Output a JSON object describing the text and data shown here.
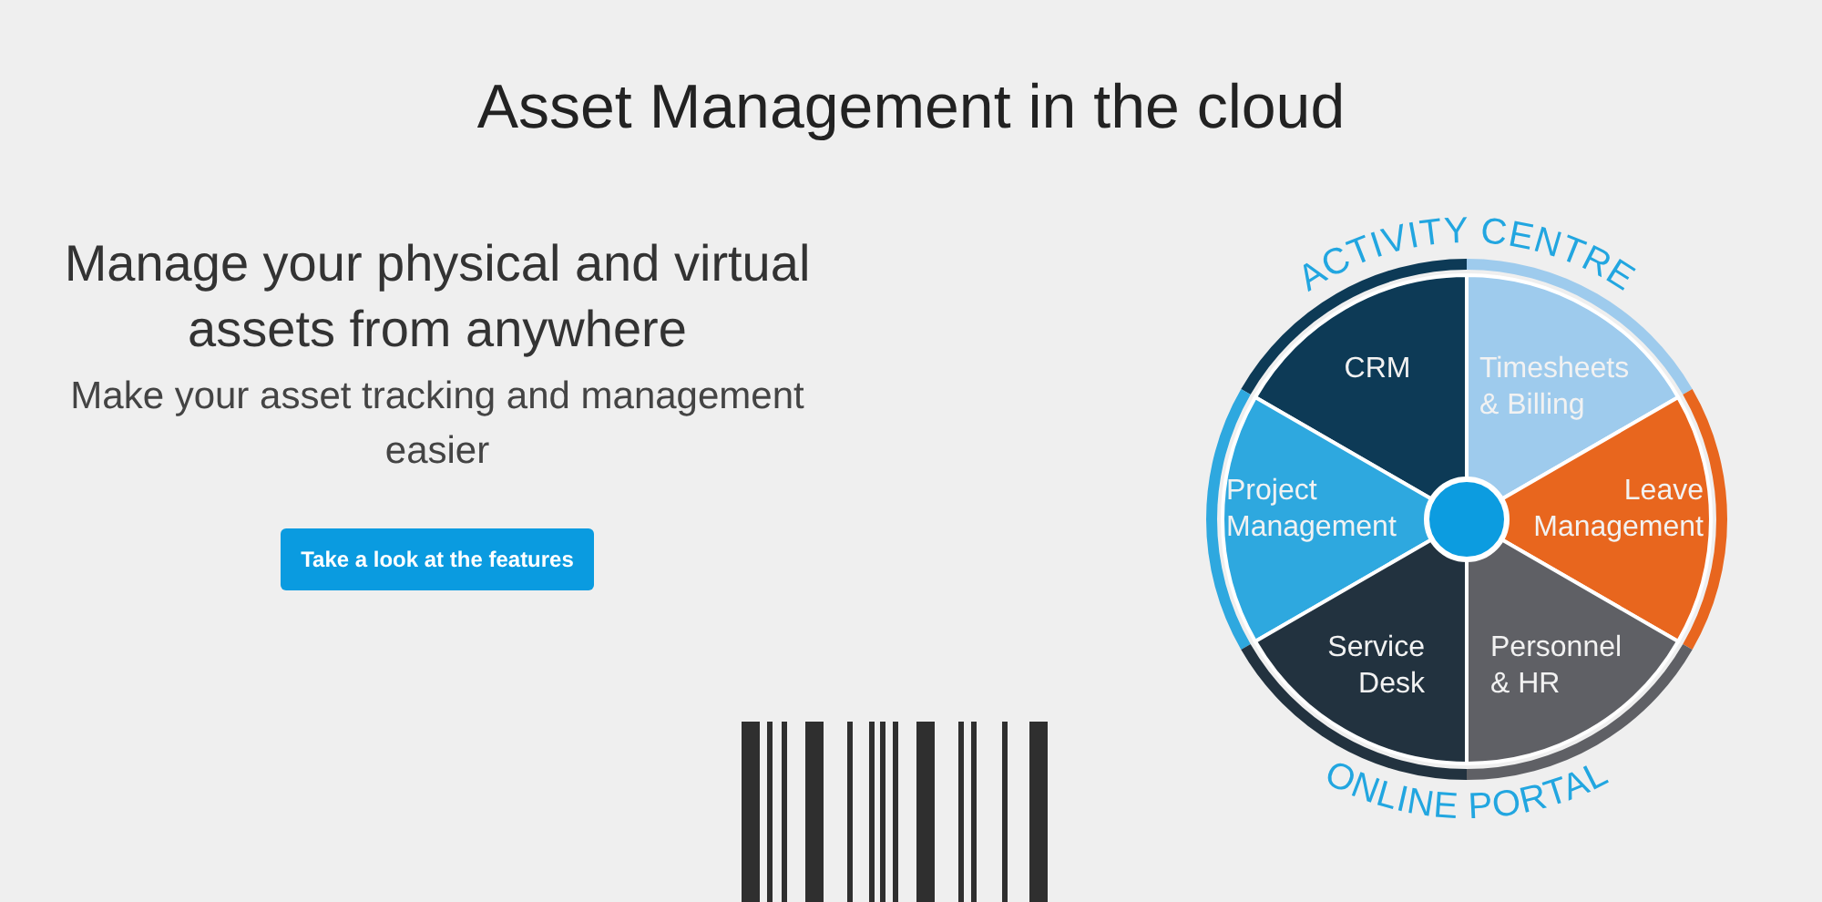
{
  "heading": "Asset Management in the cloud",
  "hero": {
    "title": "Manage your physical and virtual assets from anywhere",
    "subtitle": "Make your asset tracking and management easier",
    "button": "Take a look at the features"
  },
  "wheel": {
    "top_label": "ACTIVITY CENTRE",
    "bottom_label": "ONLINE PORTAL",
    "segments": [
      {
        "lines": [
          "CRM"
        ],
        "color": "#0d3a56"
      },
      {
        "lines": [
          "Timesheets",
          "& Billing"
        ],
        "color": "#9ecbed"
      },
      {
        "lines": [
          "Project",
          "Management"
        ],
        "color": "#2ea8df"
      },
      {
        "lines": [
          "Leave",
          "Management"
        ],
        "color": "#e8661e"
      },
      {
        "lines": [
          "Service",
          "Desk"
        ],
        "color": "#22323f"
      },
      {
        "lines": [
          "Personnel",
          "& HR"
        ],
        "color": "#5f6065"
      }
    ]
  }
}
